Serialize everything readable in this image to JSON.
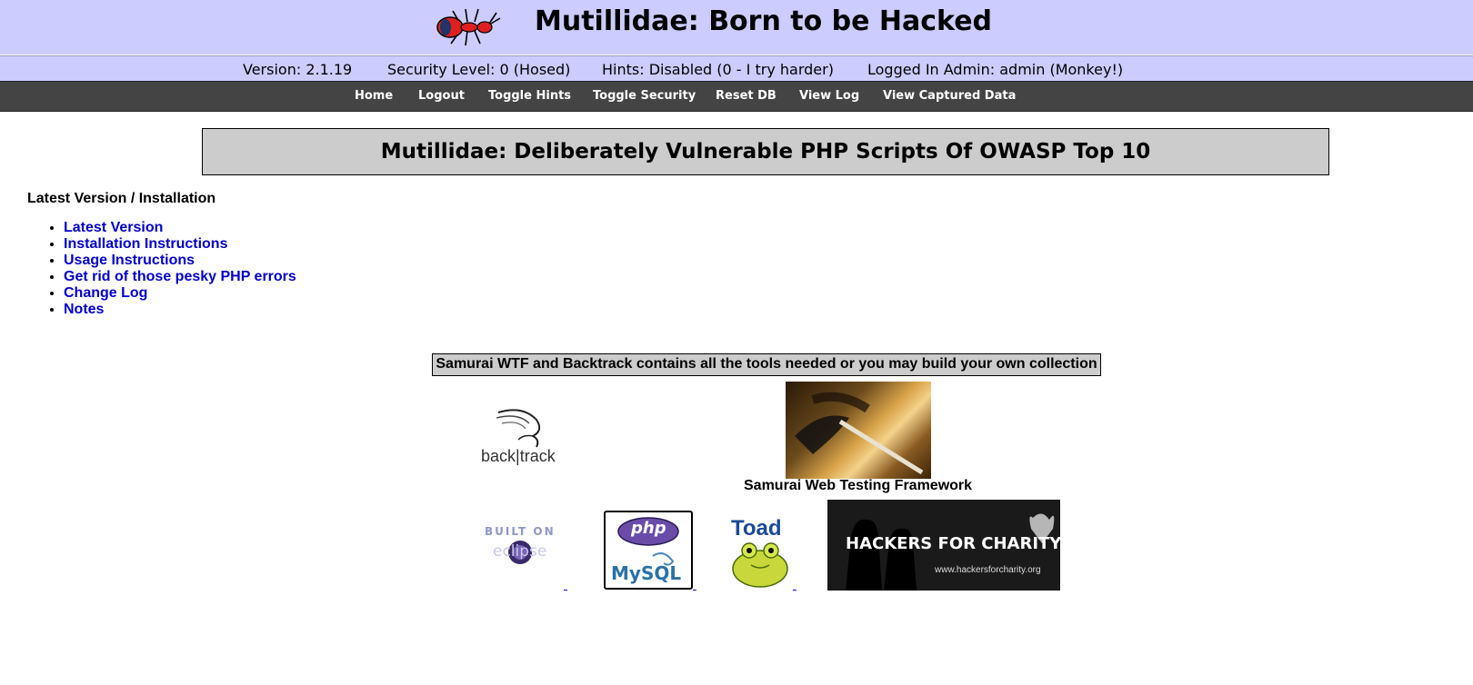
{
  "header": {
    "title": "Mutillidae: Born to be Hacked",
    "logo_icon": "ant-icon"
  },
  "status": {
    "version": "Version: 2.1.19",
    "security": "Security Level: 0 (Hosed)",
    "hints": "Hints: Disabled (0 - I try harder)",
    "user": "Logged In Admin: admin (Monkey!)"
  },
  "nav": {
    "home": "Home",
    "logout": "Logout",
    "toggle_hints": "Toggle Hints",
    "toggle_security": "Toggle Security",
    "reset_db": "Reset DB",
    "view_log": "View Log",
    "view_captured": "View Captured Data"
  },
  "main": {
    "banner": "Mutillidae: Deliberately Vulnerable PHP Scripts Of OWASP Top 10",
    "section_heading": "Latest Version / Installation",
    "links": [
      "Latest Version",
      "Installation Instructions",
      "Usage Instructions",
      "Get rid of those pesky PHP errors",
      "Change Log",
      "Notes"
    ]
  },
  "tools": {
    "banner": "Samurai WTF and Backtrack contains all the tools needed or you may build your own collection",
    "backtrack_label": "back|track",
    "samurai_caption": "Samurai Web Testing Framework",
    "eclipse_top": "BUILT ON",
    "eclipse_bottom": "eclipse",
    "php_label": "php",
    "mysql_label": "MySQL",
    "toad_label": "Toad",
    "hfc_label": "HACKERS FOR CHARITY",
    "hfc_url": "www.hackersforcharity.org"
  },
  "colors": {
    "header_bg": "#ccccff",
    "nav_bg": "#444444",
    "link": "#0000cc",
    "banner_bg": "#cccccc"
  }
}
